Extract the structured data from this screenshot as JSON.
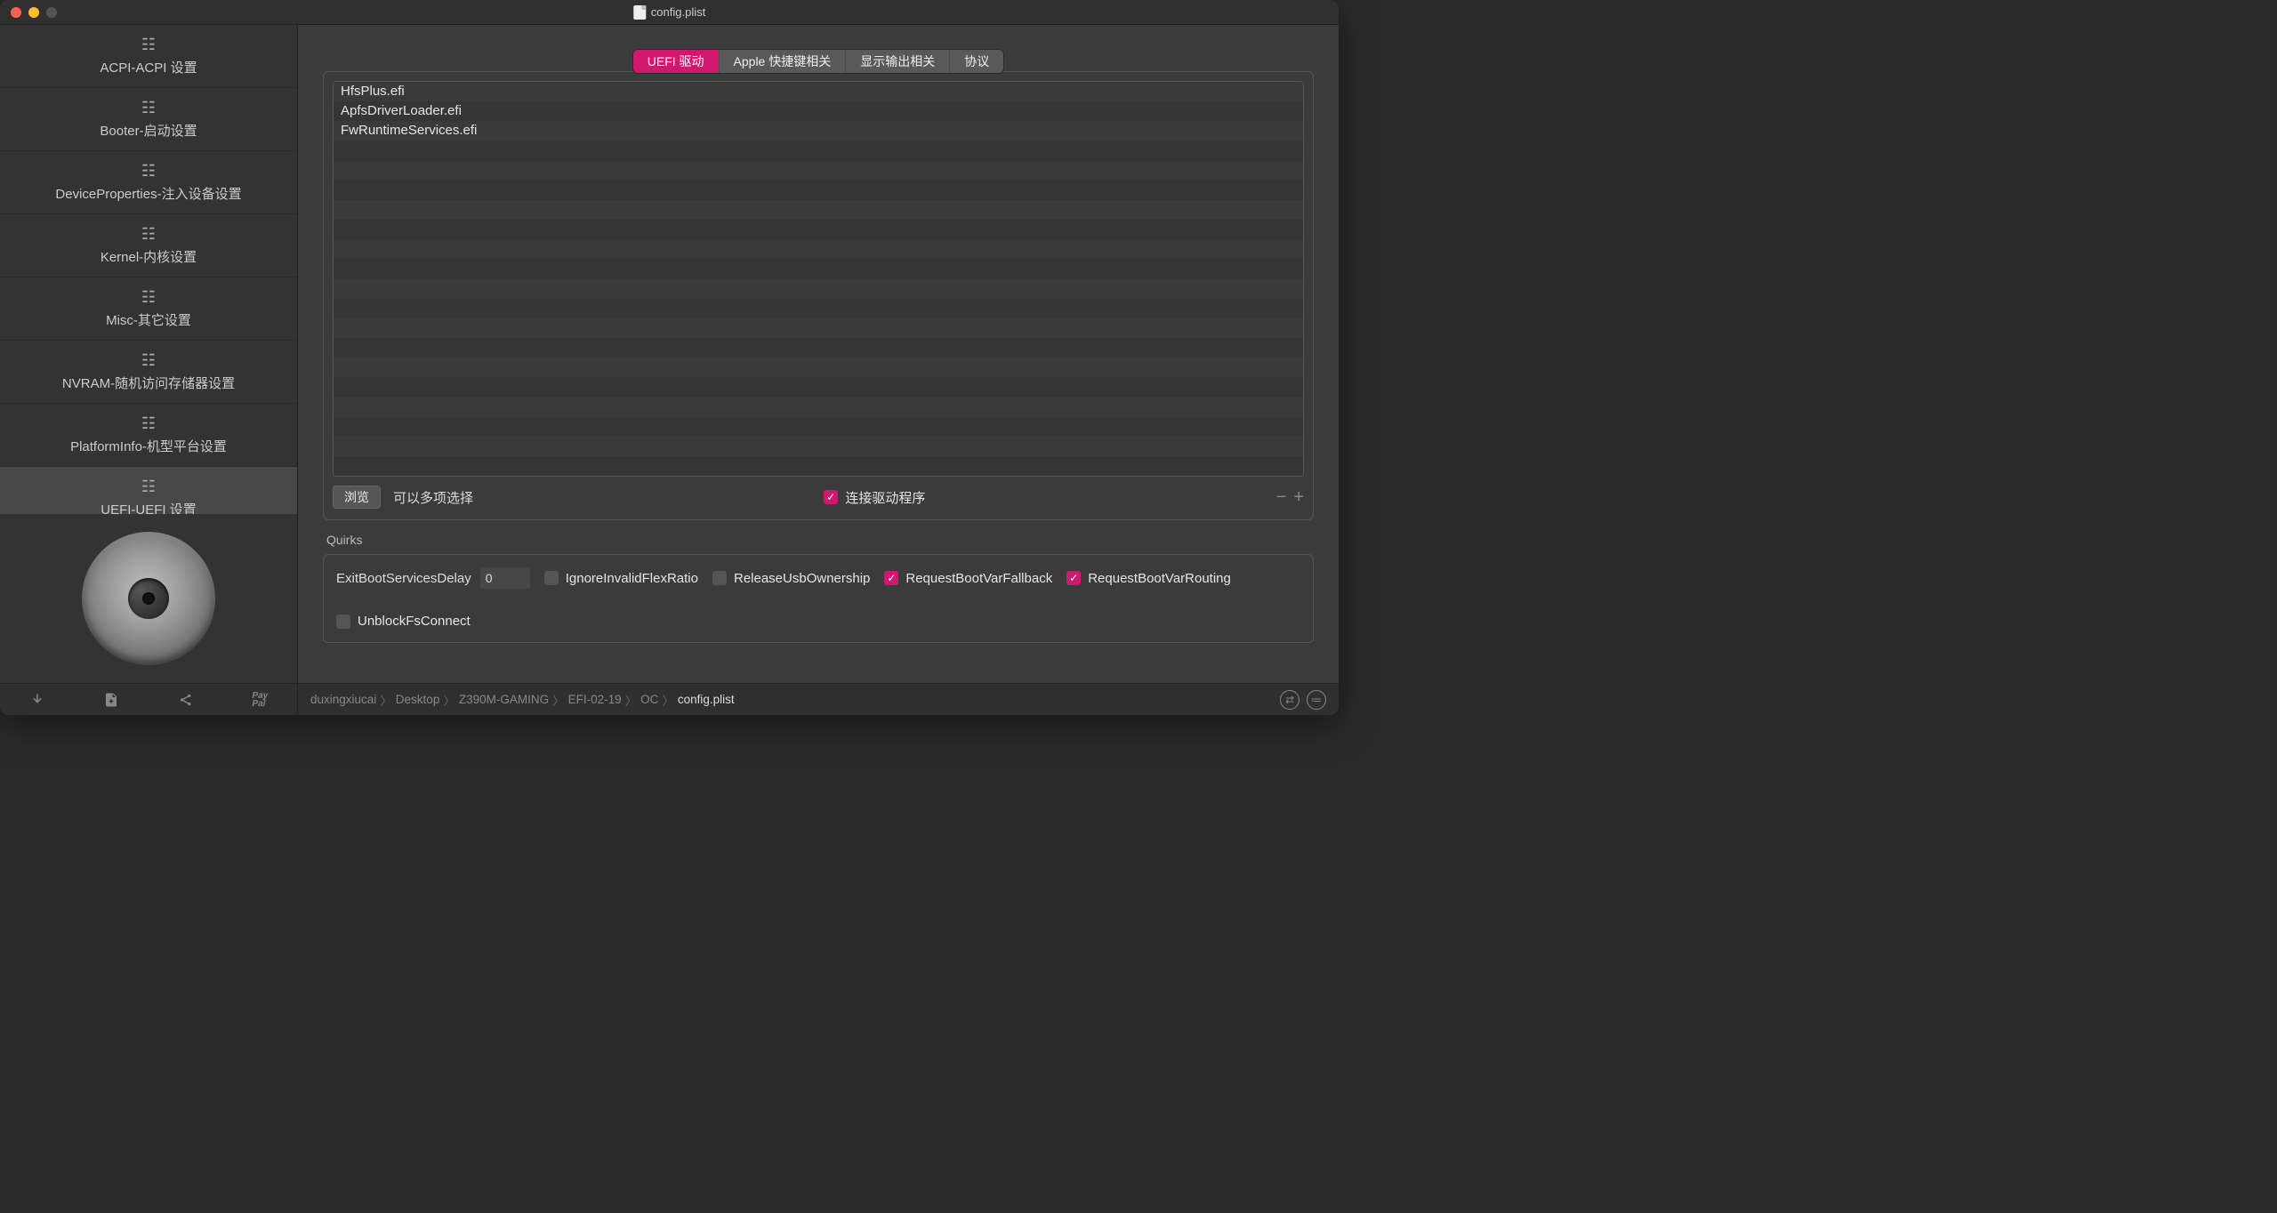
{
  "window": {
    "title": "config.plist"
  },
  "sidebar": {
    "items": [
      {
        "label": "ACPI-ACPI 设置"
      },
      {
        "label": "Booter-启动设置"
      },
      {
        "label": "DeviceProperties-注入设备设置"
      },
      {
        "label": "Kernel-内核设置"
      },
      {
        "label": "Misc-其它设置"
      },
      {
        "label": "NVRAM-随机访问存储器设置"
      },
      {
        "label": "PlatformInfo-机型平台设置"
      },
      {
        "label": "UEFI-UEFI 设置"
      }
    ],
    "active_index": 7
  },
  "tabs": {
    "items": [
      {
        "label": "UEFI 驱动"
      },
      {
        "label": "Apple 快捷键相关"
      },
      {
        "label": "显示输出相关"
      },
      {
        "label": "协议"
      }
    ],
    "active_index": 0
  },
  "drivers": [
    "HfsPlus.efi",
    "ApfsDriverLoader.efi",
    "FwRuntimeServices.efi"
  ],
  "panel": {
    "browse_label": "浏览",
    "multi_hint": "可以多项选择",
    "connect_drivers_label": "连接驱动程序",
    "connect_drivers_checked": true,
    "minus": "−",
    "plus": "+"
  },
  "quirks": {
    "title": "Quirks",
    "exit_delay_label": "ExitBootServicesDelay",
    "exit_delay_value": "0",
    "items": [
      {
        "label": "IgnoreInvalidFlexRatio",
        "checked": false
      },
      {
        "label": "ReleaseUsbOwnership",
        "checked": false
      },
      {
        "label": "RequestBootVarFallback",
        "checked": true
      },
      {
        "label": "RequestBootVarRouting",
        "checked": true
      },
      {
        "label": "UnblockFsConnect",
        "checked": false
      }
    ]
  },
  "breadcrumb": [
    "duxingxiucai",
    "Desktop",
    "Z390M-GAMING",
    "EFI-02-19",
    "OC",
    "config.plist"
  ],
  "icons": {
    "list": "☷",
    "checkmark": "✓",
    "sync": "⇄",
    "menu": "☰",
    "export": "↪",
    "save": "📄",
    "share": "❮❯"
  }
}
